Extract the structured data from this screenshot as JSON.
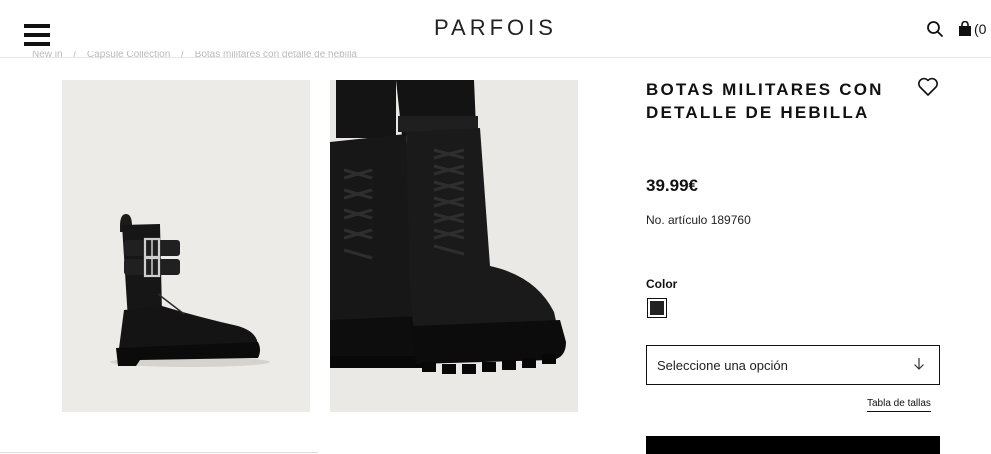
{
  "header": {
    "logo": "PARFOIS",
    "cart_count": "(0"
  },
  "breadcrumb": {
    "items": [
      "New in",
      "Capsule Collection",
      "Botas militares con detalle de hebilla"
    ]
  },
  "gallery": {
    "background_color": "#edebe7"
  },
  "product": {
    "title": "BOTAS MILITARES CON DETALLE DE HEBILLA",
    "price": "39.99€",
    "sku": "No. artículo 189760",
    "color_label": "Color",
    "swatch_color": "#222222",
    "size_placeholder": "Seleccione una opción",
    "size_guide": "Tabla de tallas"
  },
  "icons": {
    "menu": "hamburger-menu-icon",
    "search": "search-icon",
    "cart": "shopping-bag-icon",
    "wishlist": "heart-icon",
    "select_arrow": "arrow-down-icon"
  }
}
